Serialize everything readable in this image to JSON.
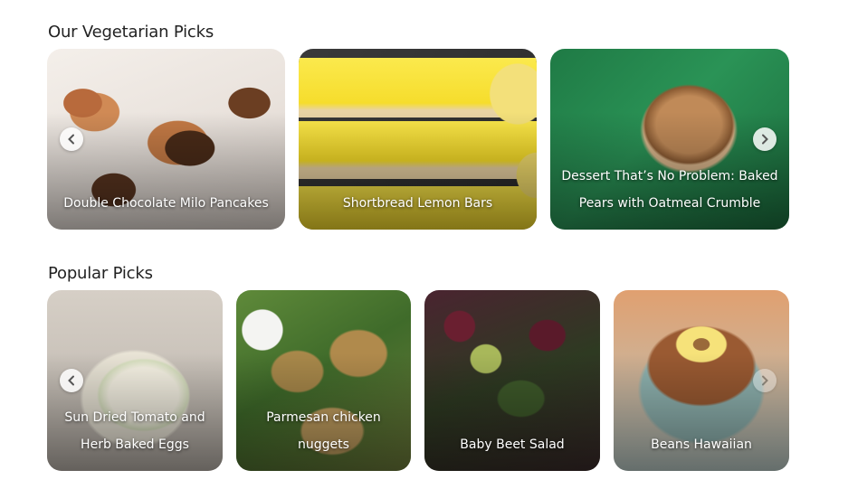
{
  "vegetarian": {
    "title": "Our Vegetarian Picks",
    "cards": [
      {
        "title": "Double Chocolate Milo Pancakes"
      },
      {
        "title": "Shortbread Lemon Bars"
      },
      {
        "title": "Dessert That’s No Problem: Baked Pears with Oatmeal Crumble"
      }
    ]
  },
  "popular": {
    "title": "Popular Picks",
    "cards": [
      {
        "title": "Sun Dried Tomato and Herb Baked Eggs"
      },
      {
        "title": "Parmesan chicken nuggets"
      },
      {
        "title": "Baby Beet Salad"
      },
      {
        "title": "Beans Hawaiian"
      }
    ]
  },
  "icons": {
    "prev": "chevron-left-icon",
    "next": "chevron-right-icon"
  }
}
